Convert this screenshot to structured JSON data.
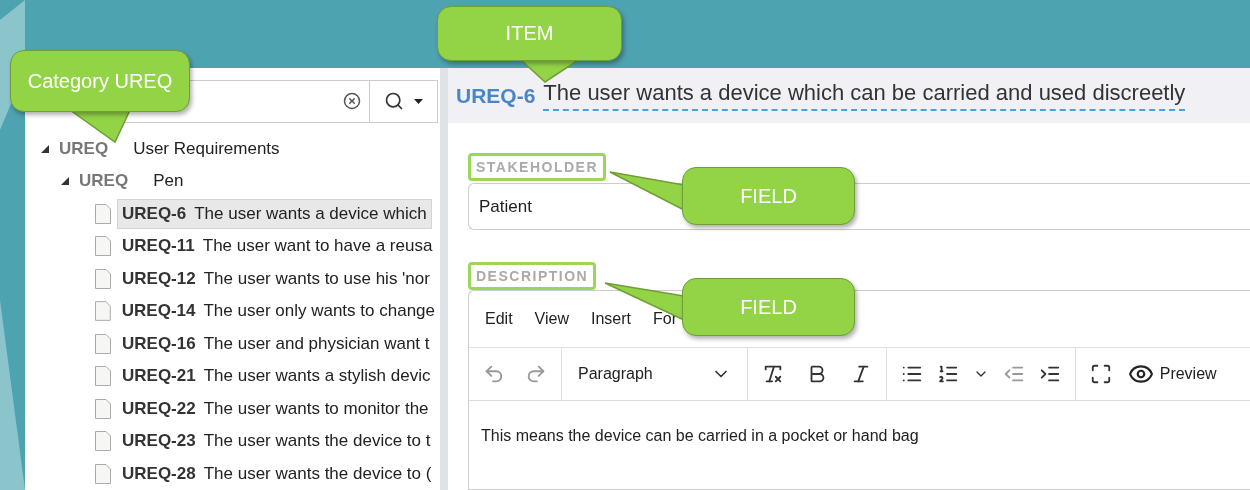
{
  "annotations": [
    {
      "text": "Category UREQ"
    },
    {
      "text": "ITEM"
    },
    {
      "text": "FIELD"
    },
    {
      "text": "FIELD"
    }
  ],
  "tree": [
    {
      "kind": "category",
      "code": "UREQ",
      "label": "User Requirements",
      "expanded": true,
      "children": [
        {
          "kind": "category",
          "code": "UREQ",
          "label": "Pen",
          "expanded": true,
          "children": [
            {
              "kind": "item",
              "code": "UREQ-6",
              "label": "The user wants a device which",
              "selected": true
            },
            {
              "kind": "item",
              "code": "UREQ-11",
              "label": "The user want to have a reusa",
              "selected": false
            },
            {
              "kind": "item",
              "code": "UREQ-12",
              "label": "The user wants to use his 'nor",
              "selected": false
            },
            {
              "kind": "item",
              "code": "UREQ-14",
              "label": "The user only wants to change",
              "selected": false
            },
            {
              "kind": "item",
              "code": "UREQ-16",
              "label": "The user and physician want t",
              "selected": false
            },
            {
              "kind": "item",
              "code": "UREQ-21",
              "label": "The user wants a stylish devic",
              "selected": false
            },
            {
              "kind": "item",
              "code": "UREQ-22",
              "label": "The user wants to monitor the",
              "selected": false
            },
            {
              "kind": "item",
              "code": "UREQ-23",
              "label": "The user wants the device to t",
              "selected": false
            },
            {
              "kind": "item",
              "code": "UREQ-28",
              "label": "The user wants the device to (",
              "selected": false
            }
          ]
        }
      ]
    }
  ],
  "item": {
    "id": "UREQ-6",
    "title": "The user wants a device which can be carried and used discreetly"
  },
  "fields": [
    {
      "kind": "text",
      "label": "STAKEHOLDER",
      "highlighted": true,
      "value": "Patient"
    },
    {
      "kind": "richtext",
      "label": "DESCRIPTION",
      "highlighted": true,
      "menu": [
        "Edit",
        "View",
        "Insert",
        "For"
      ],
      "style_select": "Paragraph",
      "preview": "Preview",
      "value": "This means the device can be carried in a pocket or hand bag"
    }
  ]
}
